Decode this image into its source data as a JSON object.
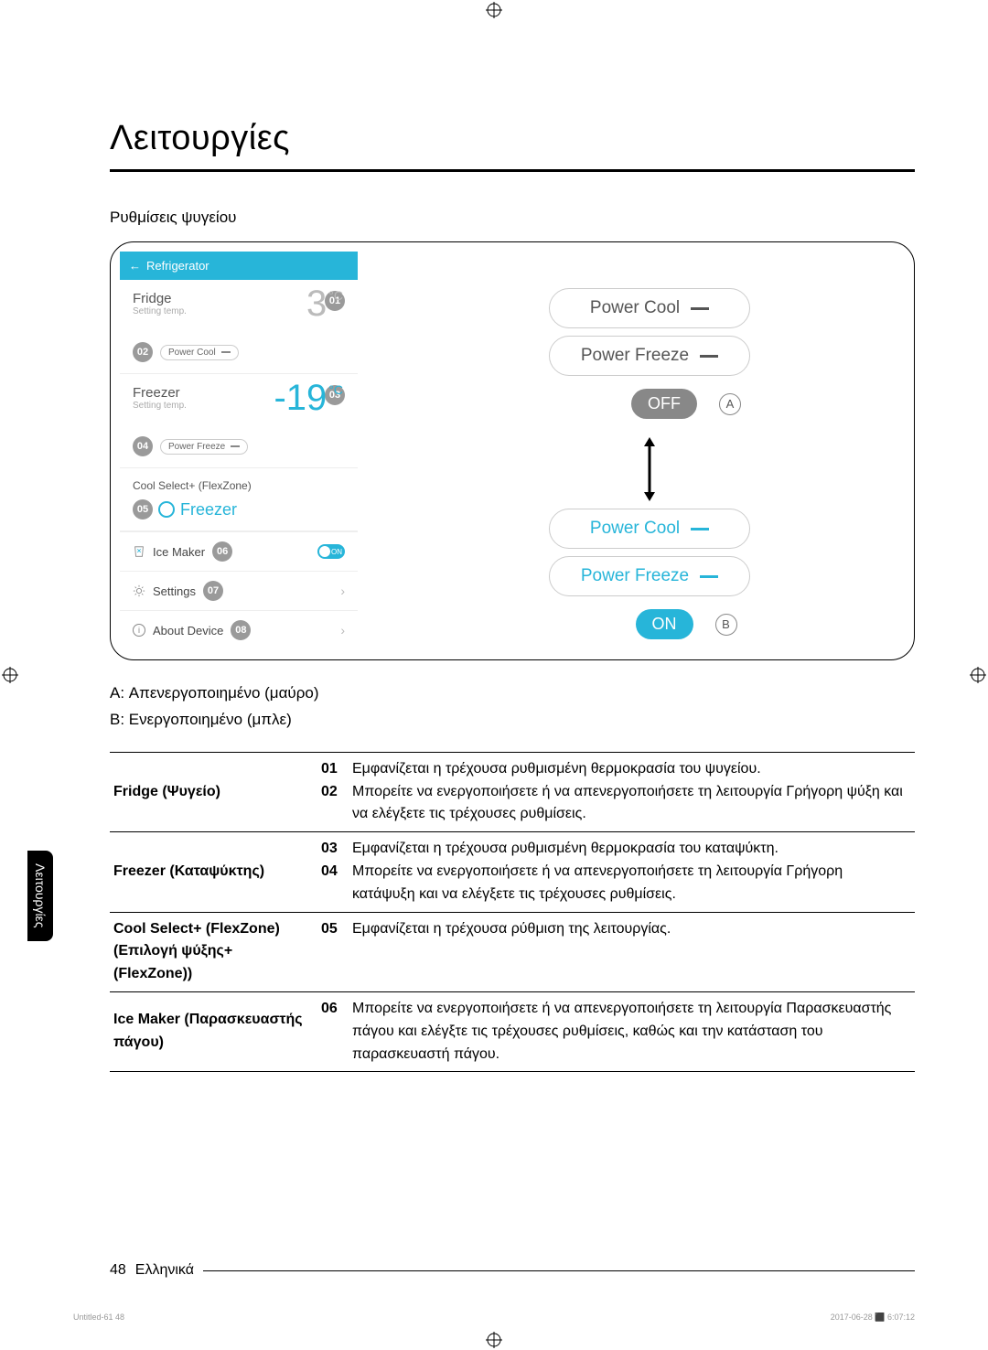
{
  "title": "Λειτουργίες",
  "section_sub": "Ρυθμίσεις ψυγείου",
  "phone": {
    "header": "Refrigerator",
    "fridge": {
      "label": "Fridge",
      "sub": "Setting temp.",
      "temp": "3",
      "unit": "°C",
      "bubble": "01"
    },
    "power_cool_bubble": "02",
    "power_cool_pill": "Power Cool",
    "freezer": {
      "label": "Freezer",
      "sub": "Setting temp.",
      "temp": "-19",
      "unit": "°C",
      "bubble": "03"
    },
    "power_freeze_bubble": "04",
    "power_freeze_pill": "Power Freeze",
    "flexzone": {
      "label": "Cool Select+ (FlexZone)",
      "bubble": "05",
      "mode": "Freezer"
    },
    "icemaker": {
      "label": "Ice Maker",
      "bubble": "06",
      "switch": "ON"
    },
    "settings": {
      "label": "Settings",
      "bubble": "07"
    },
    "about": {
      "label": "About Device",
      "bubble": "08"
    }
  },
  "diagram": {
    "power_cool": "Power Cool",
    "power_freeze": "Power Freeze",
    "off": "OFF",
    "on": "ON",
    "letter_a": "A",
    "letter_b": "B"
  },
  "legend": {
    "a": "A: Απενεργοποιημένο (μαύρο)",
    "b": "B: Ενεργοποιημένο (μπλε)"
  },
  "table": [
    {
      "head": "Fridge (Ψυγείο)",
      "items": [
        {
          "n": "01",
          "t": "Εμφανίζεται η τρέχουσα ρυθμισμένη θερμοκρασία του ψυγείου."
        },
        {
          "n": "02",
          "t": "Μπορείτε να ενεργοποιήσετε ή να απενεργοποιήσετε τη λειτουργία Γρήγορη ψύξη και να ελέγξετε τις τρέχουσες ρυθμίσεις."
        }
      ]
    },
    {
      "head": "Freezer (Καταψύκτης)",
      "items": [
        {
          "n": "03",
          "t": "Εμφανίζεται η τρέχουσα ρυθμισμένη θερμοκρασία του καταψύκτη."
        },
        {
          "n": "04",
          "t": "Μπορείτε να ενεργοποιήσετε ή να απενεργοποιήσετε τη λειτουργία Γρήγορη κατάψυξη και να ελέγξετε τις τρέχουσες ρυθμίσεις."
        }
      ]
    },
    {
      "head": "Cool Select+ (FlexZone) (Επιλογή ψύξης+ (FlexZone))",
      "items": [
        {
          "n": "05",
          "t": "Εμφανίζεται η τρέχουσα ρύθμιση της λειτουργίας."
        }
      ]
    },
    {
      "head": "Ice Maker (Παρασκευαστής πάγου)",
      "items": [
        {
          "n": "06",
          "t": "Μπορείτε να ενεργοποιήσετε ή να απενεργοποιήσετε τη λειτουργία Παρασκευαστής πάγου και ελέγξτε τις τρέχουσες ρυθμίσεις, καθώς και την κατάσταση του παρασκευαστή πάγου."
        }
      ]
    }
  ],
  "footer": {
    "page": "48",
    "lang": "Ελληνικά"
  },
  "tiny": {
    "left": "Untitled-61   48",
    "right": "2017-06-28   ⬛ 6:07:12"
  },
  "sidetab": "Λειτουργίες"
}
